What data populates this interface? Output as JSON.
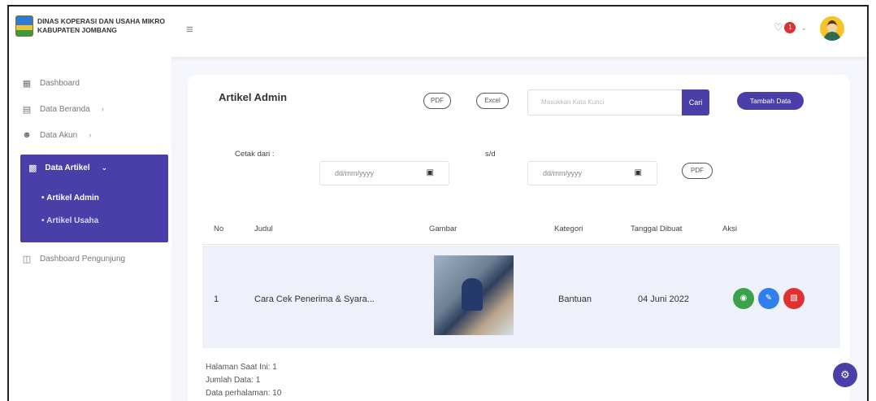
{
  "header": {
    "brand_line1": "DINAS KOPERASI DAN USAHA MIKRO",
    "brand_line2": "KABUPATEN JOMBANG",
    "notification_count": "1"
  },
  "sidebar": {
    "items": [
      {
        "label": "Dashboard",
        "icon": "grid-icon"
      },
      {
        "label": "Data Beranda",
        "icon": "document-icon"
      },
      {
        "label": "Data Akun",
        "icon": "user-icon"
      },
      {
        "label": "Data Artikel",
        "icon": "article-icon"
      },
      {
        "label": "Dashboard Pengunjung",
        "icon": "calendar-icon"
      }
    ],
    "subitems": [
      {
        "label": "Artikel Admin"
      },
      {
        "label": "Artikel Usaha"
      }
    ],
    "active_color": "#4a3fa8"
  },
  "card": {
    "title": "Artikel Admin",
    "pdf_label": "PDF",
    "excel_label": "Excel",
    "search_placeholder": "Masukkan Kata Kunci",
    "search_button": "Cari",
    "add_button": "Tambah Data",
    "print_from_label": "Cetak dari :",
    "date_from_placeholder": "dd/mm/yyyy",
    "until_label": "s/d",
    "date_to_placeholder": "dd/mm/yyyy",
    "print_pdf_label": "PDF"
  },
  "table": {
    "headers": [
      "No",
      "Judul",
      "Gambar",
      "Kategori",
      "Tanggal Dibuat",
      "Aksi"
    ],
    "rows": [
      {
        "no": "1",
        "judul": "Cara Cek Penerima & Syara...",
        "kategori": "Bantuan",
        "tanggal": "04 Juni 2022"
      }
    ]
  },
  "pagination": {
    "current_page": "Halaman Saat Ini: 1",
    "total_data": "Jumlah Data: 1",
    "per_page": "Data perhalaman: 10"
  }
}
